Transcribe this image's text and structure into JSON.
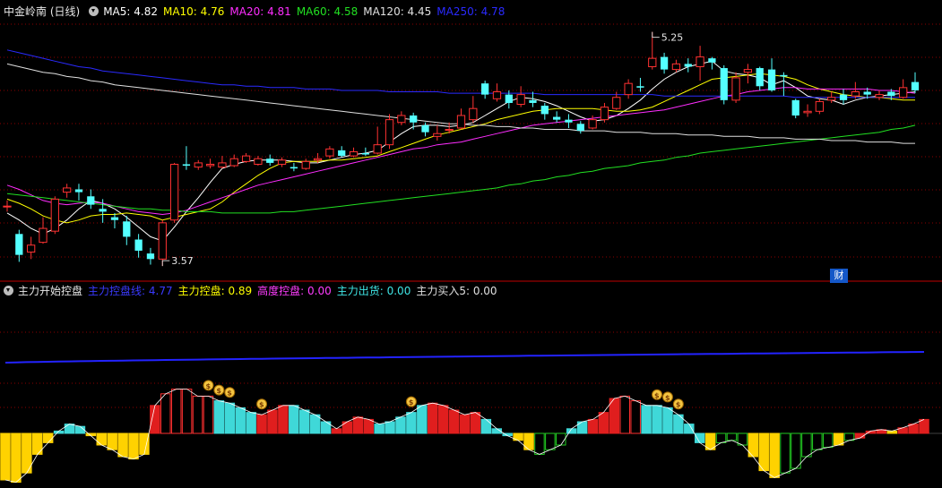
{
  "header": {
    "title": "中金岭南 (日线)",
    "ma": [
      {
        "label": "MA5: 4.82",
        "color": "#ffffff"
      },
      {
        "label": "MA10: 4.76",
        "color": "#ffff00"
      },
      {
        "label": "MA20: 4.81",
        "color": "#ff2dff"
      },
      {
        "label": "MA60: 4.58",
        "color": "#22e022"
      },
      {
        "label": "MA120: 4.45",
        "color": "#e0e0e0"
      },
      {
        "label": "MA250: 4.78",
        "color": "#2a2aff"
      }
    ]
  },
  "indicator_header": {
    "title": "主力开始控盘",
    "items": [
      {
        "label": "主力控盘线: 4.77",
        "color": "#3a3aff"
      },
      {
        "label": "主力控盘: 0.89",
        "color": "#ffff00"
      },
      {
        "label": "高度控盘: 0.00",
        "color": "#ff3cff"
      },
      {
        "label": "主力出货: 0.00",
        "color": "#3fe5e5"
      },
      {
        "label": "主力买入5: 0.00",
        "color": "#e0e0e0"
      }
    ]
  },
  "badge": "财",
  "colors": {
    "up": "#ff3232",
    "down": "#54ffff",
    "grid": "#8b0000",
    "bg": "#000000"
  },
  "chart_data": [
    {
      "type": "candlestick",
      "annotations": [
        {
          "text": "5.25",
          "type": "high"
        },
        {
          "text": "3.57",
          "type": "low"
        }
      ],
      "ylim": [
        3.5,
        5.35
      ],
      "candles": [
        [
          4.0,
          4.0,
          4.04,
          3.96
        ],
        [
          3.8,
          3.65,
          3.83,
          3.6
        ],
        [
          3.67,
          3.72,
          3.78,
          3.62
        ],
        [
          3.74,
          3.84,
          3.92,
          3.73
        ],
        [
          3.82,
          4.05,
          4.07,
          3.8
        ],
        [
          4.1,
          4.13,
          4.16,
          4.06
        ],
        [
          4.12,
          4.1,
          4.16,
          4.04
        ],
        [
          4.07,
          4.01,
          4.12,
          3.98
        ],
        [
          3.98,
          3.96,
          4.05,
          3.88
        ],
        [
          3.92,
          3.9,
          3.95,
          3.84
        ],
        [
          3.89,
          3.78,
          3.93,
          3.72
        ],
        [
          3.76,
          3.68,
          3.8,
          3.63
        ],
        [
          3.66,
          3.62,
          3.7,
          3.58
        ],
        [
          3.62,
          3.88,
          3.9,
          3.57
        ],
        [
          3.9,
          4.3,
          4.31,
          3.88
        ],
        [
          4.3,
          4.29,
          4.43,
          4.26
        ],
        [
          4.28,
          4.31,
          4.33,
          4.26
        ],
        [
          4.29,
          4.3,
          4.34,
          4.27
        ],
        [
          4.28,
          4.31,
          4.36,
          4.27
        ],
        [
          4.29,
          4.34,
          4.37,
          4.28
        ],
        [
          4.32,
          4.36,
          4.38,
          4.31
        ],
        [
          4.3,
          4.34,
          4.36,
          4.29
        ],
        [
          4.34,
          4.31,
          4.37,
          4.29
        ],
        [
          4.3,
          4.33,
          4.35,
          4.28
        ],
        [
          4.28,
          4.27,
          4.31,
          4.25
        ],
        [
          4.27,
          4.32,
          4.34,
          4.26
        ],
        [
          4.33,
          4.34,
          4.38,
          4.31
        ],
        [
          4.36,
          4.41,
          4.43,
          4.34
        ],
        [
          4.4,
          4.36,
          4.43,
          4.35
        ],
        [
          4.36,
          4.39,
          4.42,
          4.35
        ],
        [
          4.38,
          4.37,
          4.42,
          4.36
        ],
        [
          4.38,
          4.44,
          4.57,
          4.37
        ],
        [
          4.44,
          4.62,
          4.66,
          4.41
        ],
        [
          4.6,
          4.65,
          4.68,
          4.58
        ],
        [
          4.65,
          4.6,
          4.67,
          4.55
        ],
        [
          4.58,
          4.53,
          4.6,
          4.5
        ],
        [
          4.5,
          4.52,
          4.58,
          4.47
        ],
        [
          4.55,
          4.55,
          4.6,
          4.52
        ],
        [
          4.56,
          4.65,
          4.7,
          4.55
        ],
        [
          4.62,
          4.7,
          4.79,
          4.6
        ],
        [
          4.88,
          4.8,
          4.9,
          4.77
        ],
        [
          4.77,
          4.82,
          4.88,
          4.75
        ],
        [
          4.8,
          4.74,
          4.83,
          4.7
        ],
        [
          4.73,
          4.8,
          4.86,
          4.71
        ],
        [
          4.76,
          4.74,
          4.82,
          4.71
        ],
        [
          4.72,
          4.66,
          4.74,
          4.62
        ],
        [
          4.64,
          4.62,
          4.68,
          4.6
        ],
        [
          4.62,
          4.6,
          4.66,
          4.56
        ],
        [
          4.59,
          4.54,
          4.61,
          4.52
        ],
        [
          4.56,
          4.62,
          4.65,
          4.55
        ],
        [
          4.62,
          4.71,
          4.74,
          4.6
        ],
        [
          4.7,
          4.78,
          4.82,
          4.69
        ],
        [
          4.8,
          4.88,
          4.91,
          4.77
        ],
        [
          4.86,
          4.85,
          4.92,
          4.82
        ],
        [
          5.0,
          5.06,
          5.25,
          4.98
        ],
        [
          5.07,
          4.98,
          5.1,
          4.95
        ],
        [
          4.98,
          5.02,
          5.05,
          4.96
        ],
        [
          5.02,
          5.0,
          5.06,
          4.96
        ],
        [
          5.0,
          5.07,
          5.15,
          4.9
        ],
        [
          5.06,
          5.03,
          5.07,
          4.98
        ],
        [
          4.99,
          4.76,
          5.01,
          4.73
        ],
        [
          4.76,
          4.92,
          4.96,
          4.74
        ],
        [
          4.96,
          4.98,
          5.02,
          4.88
        ],
        [
          4.99,
          4.86,
          5.0,
          4.83
        ],
        [
          4.98,
          4.83,
          5.06,
          4.82
        ],
        [
          4.94,
          4.93,
          4.96,
          4.79
        ],
        [
          4.76,
          4.65,
          4.77,
          4.63
        ],
        [
          4.67,
          4.68,
          4.73,
          4.64
        ],
        [
          4.68,
          4.75,
          4.77,
          4.66
        ],
        [
          4.76,
          4.78,
          4.82,
          4.74
        ],
        [
          4.8,
          4.76,
          4.84,
          4.73
        ],
        [
          4.79,
          4.82,
          4.89,
          4.77
        ],
        [
          4.82,
          4.8,
          4.85,
          4.77
        ],
        [
          4.78,
          4.8,
          4.83,
          4.76
        ],
        [
          4.82,
          4.79,
          4.84,
          4.76
        ],
        [
          4.78,
          4.85,
          4.91,
          4.77
        ],
        [
          4.89,
          4.83,
          4.96,
          4.81
        ]
      ],
      "ma": {
        "MA5": [
          3.95,
          3.9,
          3.84,
          3.8,
          3.84,
          3.9,
          3.98,
          4.04,
          4.02,
          3.98,
          3.92,
          3.85,
          3.78,
          3.75,
          3.85,
          3.96,
          4.06,
          4.17,
          4.27,
          4.3,
          4.32,
          4.33,
          4.33,
          4.33,
          4.32,
          4.31,
          4.31,
          4.33,
          4.35,
          4.37,
          4.38,
          4.4,
          4.46,
          4.52,
          4.57,
          4.58,
          4.58,
          4.57,
          4.58,
          4.6,
          4.65,
          4.7,
          4.75,
          4.78,
          4.77,
          4.75,
          4.72,
          4.68,
          4.64,
          4.61,
          4.62,
          4.65,
          4.7,
          4.76,
          4.84,
          4.91,
          4.96,
          5.0,
          5.02,
          5.04,
          4.97,
          4.95,
          4.94,
          4.92,
          4.87,
          4.9,
          4.85,
          4.79,
          4.77,
          4.76,
          4.73,
          4.76,
          4.78,
          4.79,
          4.8,
          4.81,
          4.82
        ],
        "MA10": [
          4.05,
          4.02,
          3.98,
          3.93,
          3.9,
          3.88,
          3.9,
          3.93,
          3.94,
          3.94,
          3.95,
          3.94,
          3.93,
          3.9,
          3.92,
          3.94,
          3.96,
          3.98,
          4.03,
          4.1,
          4.16,
          4.22,
          4.27,
          4.31,
          4.32,
          4.32,
          4.32,
          4.33,
          4.33,
          4.34,
          4.35,
          4.36,
          4.39,
          4.42,
          4.45,
          4.48,
          4.51,
          4.53,
          4.55,
          4.57,
          4.59,
          4.62,
          4.64,
          4.66,
          4.68,
          4.69,
          4.7,
          4.7,
          4.7,
          4.7,
          4.69,
          4.68,
          4.68,
          4.69,
          4.71,
          4.75,
          4.79,
          4.83,
          4.87,
          4.91,
          4.92,
          4.93,
          4.94,
          4.95,
          4.94,
          4.93,
          4.91,
          4.87,
          4.84,
          4.82,
          4.8,
          4.79,
          4.78,
          4.78,
          4.77,
          4.76,
          4.76
        ],
        "MA20": [
          4.15,
          4.12,
          4.08,
          4.04,
          4.02,
          4.01,
          4.02,
          4.03,
          4.02,
          4.0,
          3.98,
          3.96,
          3.95,
          3.94,
          3.95,
          3.97,
          4.0,
          4.03,
          4.06,
          4.09,
          4.12,
          4.15,
          4.17,
          4.19,
          4.21,
          4.23,
          4.25,
          4.27,
          4.29,
          4.31,
          4.33,
          4.35,
          4.37,
          4.39,
          4.41,
          4.42,
          4.44,
          4.45,
          4.46,
          4.48,
          4.5,
          4.52,
          4.54,
          4.56,
          4.58,
          4.59,
          4.6,
          4.61,
          4.62,
          4.63,
          4.64,
          4.65,
          4.66,
          4.67,
          4.68,
          4.69,
          4.71,
          4.73,
          4.75,
          4.77,
          4.79,
          4.8,
          4.82,
          4.83,
          4.84,
          4.85,
          4.85,
          4.84,
          4.84,
          4.84,
          4.84,
          4.84,
          4.84,
          4.83,
          4.83,
          4.82,
          4.81
        ],
        "MA60": [
          4.09,
          4.08,
          4.07,
          4.06,
          4.05,
          4.04,
          4.03,
          4.02,
          4.01,
          4.0,
          3.99,
          3.98,
          3.98,
          3.97,
          3.97,
          3.96,
          3.96,
          3.96,
          3.95,
          3.95,
          3.95,
          3.95,
          3.95,
          3.96,
          3.96,
          3.97,
          3.98,
          3.99,
          4.0,
          4.01,
          4.02,
          4.03,
          4.04,
          4.05,
          4.06,
          4.07,
          4.08,
          4.09,
          4.1,
          4.11,
          4.12,
          4.13,
          4.15,
          4.16,
          4.18,
          4.19,
          4.21,
          4.22,
          4.24,
          4.25,
          4.27,
          4.28,
          4.29,
          4.31,
          4.32,
          4.33,
          4.35,
          4.36,
          4.38,
          4.39,
          4.4,
          4.41,
          4.42,
          4.43,
          4.44,
          4.45,
          4.46,
          4.47,
          4.48,
          4.49,
          4.5,
          4.51,
          4.52,
          4.53,
          4.55,
          4.56,
          4.58
        ],
        "MA120": [
          5.02,
          5.0,
          4.98,
          4.96,
          4.95,
          4.93,
          4.92,
          4.9,
          4.89,
          4.87,
          4.86,
          4.85,
          4.84,
          4.83,
          4.82,
          4.81,
          4.8,
          4.79,
          4.78,
          4.77,
          4.76,
          4.75,
          4.74,
          4.73,
          4.72,
          4.71,
          4.7,
          4.69,
          4.68,
          4.67,
          4.66,
          4.65,
          4.64,
          4.63,
          4.62,
          4.61,
          4.6,
          4.59,
          4.59,
          4.58,
          4.58,
          4.57,
          4.57,
          4.56,
          4.56,
          4.55,
          4.55,
          4.55,
          4.54,
          4.54,
          4.54,
          4.53,
          4.53,
          4.53,
          4.52,
          4.52,
          4.52,
          4.51,
          4.51,
          4.51,
          4.5,
          4.5,
          4.5,
          4.49,
          4.49,
          4.49,
          4.48,
          4.48,
          4.48,
          4.47,
          4.47,
          4.47,
          4.46,
          4.46,
          4.46,
          4.45,
          4.45
        ],
        "MA250": [
          5.12,
          5.1,
          5.08,
          5.06,
          5.04,
          5.02,
          5.0,
          4.99,
          4.97,
          4.96,
          4.95,
          4.94,
          4.93,
          4.92,
          4.91,
          4.9,
          4.89,
          4.88,
          4.87,
          4.87,
          4.86,
          4.86,
          4.85,
          4.85,
          4.85,
          4.84,
          4.84,
          4.84,
          4.83,
          4.83,
          4.83,
          4.83,
          4.82,
          4.82,
          4.82,
          4.82,
          4.82,
          4.81,
          4.81,
          4.81,
          4.81,
          4.81,
          4.81,
          4.81,
          4.81,
          4.8,
          4.8,
          4.8,
          4.8,
          4.8,
          4.8,
          4.8,
          4.8,
          4.8,
          4.8,
          4.79,
          4.79,
          4.79,
          4.79,
          4.79,
          4.79,
          4.79,
          4.79,
          4.79,
          4.79,
          4.79,
          4.78,
          4.78,
          4.78,
          4.78,
          4.78,
          4.78,
          4.78,
          4.78,
          4.78,
          4.78,
          4.78
        ]
      }
    },
    {
      "type": "bar",
      "series_control_line": "主力控盘线",
      "ylim": [
        -1.2,
        1.0
      ],
      "values": [
        -1.0,
        -1.05,
        -0.85,
        -0.45,
        -0.2,
        0.05,
        0.2,
        0.15,
        -0.05,
        -0.25,
        -0.35,
        -0.5,
        -0.55,
        -0.45,
        0.6,
        0.85,
        0.95,
        0.95,
        0.8,
        0.8,
        0.7,
        0.65,
        0.55,
        0.45,
        0.4,
        0.5,
        0.6,
        0.6,
        0.5,
        0.4,
        0.25,
        0.1,
        0.25,
        0.35,
        0.3,
        0.2,
        0.25,
        0.35,
        0.45,
        0.6,
        0.65,
        0.6,
        0.5,
        0.4,
        0.45,
        0.3,
        0.1,
        -0.05,
        -0.15,
        -0.35,
        -0.45,
        -0.35,
        -0.25,
        0.1,
        0.25,
        0.3,
        0.45,
        0.75,
        0.8,
        0.7,
        0.6,
        0.6,
        0.55,
        0.4,
        0.2,
        -0.2,
        -0.35,
        -0.2,
        -0.15,
        -0.25,
        -0.5,
        -0.8,
        -0.95,
        -0.85,
        -0.75,
        -0.5,
        -0.35,
        -0.3,
        -0.25,
        -0.15,
        -0.1,
        0.05,
        0.08,
        0.05,
        0.12,
        0.2,
        0.3
      ],
      "state": [
        "y",
        "y",
        "y",
        "y",
        "y",
        "c",
        "c",
        "c",
        "y",
        "y",
        "y",
        "y",
        "y",
        "y",
        "r",
        "o",
        "o",
        "o",
        "o",
        "o",
        "c",
        "c",
        "c",
        "c",
        "r",
        "r",
        "r",
        "c",
        "c",
        "c",
        "c",
        "r",
        "r",
        "r",
        "r",
        "c",
        "c",
        "c",
        "c",
        "c",
        "r",
        "r",
        "r",
        "r",
        "r",
        "c",
        "c",
        "c",
        "y",
        "y",
        "g",
        "g",
        "g",
        "c",
        "c",
        "r",
        "r",
        "r",
        "o",
        "o",
        "c",
        "c",
        "c",
        "c",
        "c",
        "c",
        "y",
        "g",
        "g",
        "g",
        "y",
        "y",
        "y",
        "g",
        "g",
        "g",
        "g",
        "g",
        "y",
        "g",
        "r",
        "r",
        "r",
        "y",
        "r",
        "r",
        "r"
      ],
      "markers": [
        {
          "index": 19,
          "icon": "money-bag-icon"
        },
        {
          "index": 20,
          "icon": "money-bag-icon"
        },
        {
          "index": 21,
          "icon": "money-bag-icon"
        },
        {
          "index": 24,
          "icon": "money-bag-icon"
        },
        {
          "index": 38,
          "icon": "money-bag-icon"
        },
        {
          "index": 61,
          "icon": "money-bag-icon"
        },
        {
          "index": 62,
          "icon": "money-bag-icon"
        },
        {
          "index": 63,
          "icon": "money-bag-icon"
        }
      ]
    }
  ]
}
